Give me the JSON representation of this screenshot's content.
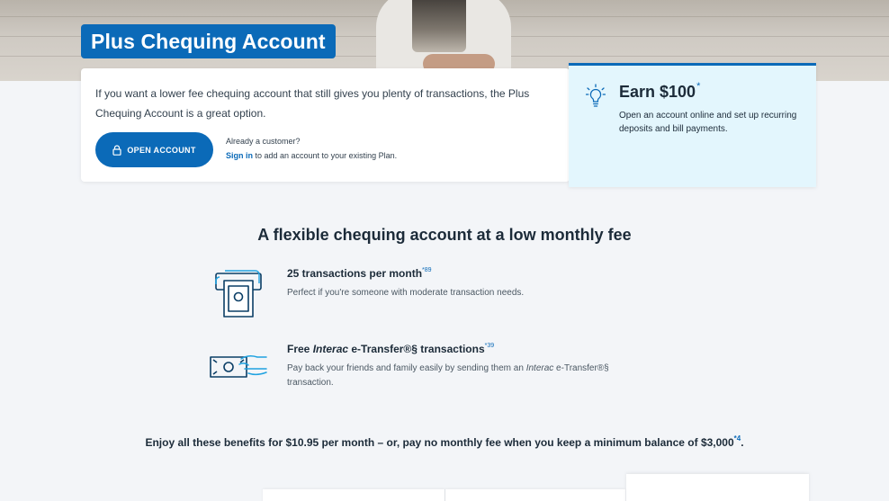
{
  "hero": {
    "title": "Plus Chequing Account"
  },
  "intro": {
    "text": "If you want a lower fee chequing account that still gives you plenty of transactions, the Plus Chequing Account is a great option.",
    "open_button": "OPEN ACCOUNT",
    "already_customer": "Already a customer?",
    "sign_in": "Sign in",
    "sign_in_suffix": " to add an account to your existing Plan."
  },
  "promo": {
    "icon": "lightbulb-icon",
    "title": "Earn $100",
    "title_mark": "*",
    "description": "Open an account online and set up recurring deposits and bill payments."
  },
  "section": {
    "title": "A flexible chequing account at a low monthly fee"
  },
  "features": [
    {
      "icon": "atm-icon",
      "title": "25 transactions per month",
      "title_mark": "*89",
      "description": "Perfect if you're someone with moderate transaction needs."
    },
    {
      "icon": "money-transfer-icon",
      "title_prefix": "Free ",
      "title_italic": "Interac",
      "title_suffix": " e-Transfer®§ transactions",
      "title_mark": "*39",
      "desc_prefix": "Pay back your friends and family easily by sending them an ",
      "desc_italic": "Interac",
      "desc_suffix": " e-Transfer®§ transaction."
    }
  ],
  "fee_note": {
    "text": "Enjoy all these benefits for $10.95 per month – or, pay no monthly fee when you keep a minimum balance of $3,000",
    "mark": "*4",
    "end": "."
  },
  "colors": {
    "brand_blue": "#0b6ab8",
    "promo_bg": "#e3f6fd",
    "page_bg": "#f3f5f8"
  }
}
